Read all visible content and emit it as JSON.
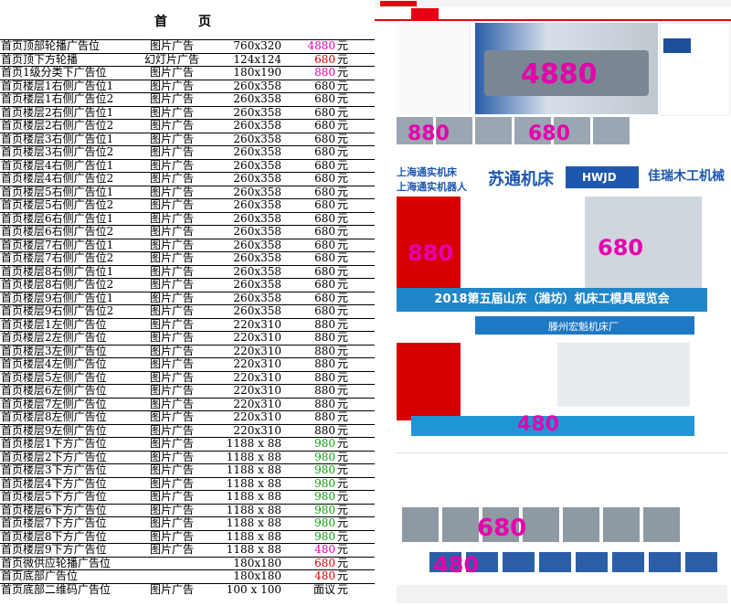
{
  "title": "首　页",
  "rows": [
    {
      "name": "首页顶部轮播广告位",
      "type": "图片广告",
      "size": "760x320",
      "price": "4880",
      "unit": "元",
      "color": "pink"
    },
    {
      "name": "首页顶下方轮播",
      "type": "幻灯片广告",
      "size": "124x124",
      "price": "680",
      "unit": "元",
      "color": "red"
    },
    {
      "name": "首页1级分类下广告位",
      "type": "图片广告",
      "size": "180x190",
      "price": "880",
      "unit": "元",
      "color": "pink"
    },
    {
      "name": "首页楼层1右侧广告位1",
      "type": "图片广告",
      "size": "260x358",
      "price": "680",
      "unit": "元",
      "color": "black"
    },
    {
      "name": "首页楼层1右侧广告位2",
      "type": "图片广告",
      "size": "260x358",
      "price": "680",
      "unit": "元",
      "color": "black"
    },
    {
      "name": "首页楼层2右侧广告位1",
      "type": "图片广告",
      "size": "260x358",
      "price": "680",
      "unit": "元",
      "color": "black"
    },
    {
      "name": "首页楼层2右侧广告位2",
      "type": "图片广告",
      "size": "260x358",
      "price": "680",
      "unit": "元",
      "color": "black"
    },
    {
      "name": "首页楼层3右侧广告位1",
      "type": "图片广告",
      "size": "260x358",
      "price": "680",
      "unit": "元",
      "color": "black"
    },
    {
      "name": "首页楼层3右侧广告位2",
      "type": "图片广告",
      "size": "260x358",
      "price": "680",
      "unit": "元",
      "color": "black"
    },
    {
      "name": "首页楼层4右侧广告位1",
      "type": "图片广告",
      "size": "260x358",
      "price": "680",
      "unit": "元",
      "color": "black"
    },
    {
      "name": "首页楼层4右侧广告位2",
      "type": "图片广告",
      "size": "260x358",
      "price": "680",
      "unit": "元",
      "color": "black"
    },
    {
      "name": "首页楼层5右侧广告位1",
      "type": "图片广告",
      "size": "260x358",
      "price": "680",
      "unit": "元",
      "color": "black"
    },
    {
      "name": "首页楼层5右侧广告位2",
      "type": "图片广告",
      "size": "260x358",
      "price": "680",
      "unit": "元",
      "color": "black"
    },
    {
      "name": "首页楼层6右侧广告位1",
      "type": "图片广告",
      "size": "260x358",
      "price": "680",
      "unit": "元",
      "color": "black"
    },
    {
      "name": "首页楼层6右侧广告位2",
      "type": "图片广告",
      "size": "260x358",
      "price": "680",
      "unit": "元",
      "color": "black"
    },
    {
      "name": "首页楼层7右侧广告位1",
      "type": "图片广告",
      "size": "260x358",
      "price": "680",
      "unit": "元",
      "color": "black"
    },
    {
      "name": "首页楼层7右侧广告位2",
      "type": "图片广告",
      "size": "260x358",
      "price": "680",
      "unit": "元",
      "color": "black"
    },
    {
      "name": "首页楼层8右侧广告位1",
      "type": "图片广告",
      "size": "260x358",
      "price": "680",
      "unit": "元",
      "color": "black"
    },
    {
      "name": "首页楼层8右侧广告位2",
      "type": "图片广告",
      "size": "260x358",
      "price": "680",
      "unit": "元",
      "color": "black"
    },
    {
      "name": "首页楼层9右侧广告位1",
      "type": "图片广告",
      "size": "260x358",
      "price": "680",
      "unit": "元",
      "color": "black"
    },
    {
      "name": "首页楼层9右侧广告位2",
      "type": "图片广告",
      "size": "260x358",
      "price": "680",
      "unit": "元",
      "color": "black"
    },
    {
      "name": "首页楼层1左侧广告位",
      "type": "图片广告",
      "size": "220x310",
      "price": "880",
      "unit": "元",
      "color": "black"
    },
    {
      "name": "首页楼层2左侧广告位",
      "type": "图片广告",
      "size": "220x310",
      "price": "880",
      "unit": "元",
      "color": "black"
    },
    {
      "name": "首页楼层3左侧广告位",
      "type": "图片广告",
      "size": "220x310",
      "price": "880",
      "unit": "元",
      "color": "black"
    },
    {
      "name": "首页楼层4左侧广告位",
      "type": "图片广告",
      "size": "220x310",
      "price": "880",
      "unit": "元",
      "color": "black"
    },
    {
      "name": "首页楼层5左侧广告位",
      "type": "图片广告",
      "size": "220x310",
      "price": "880",
      "unit": "元",
      "color": "black"
    },
    {
      "name": "首页楼层6左侧广告位",
      "type": "图片广告",
      "size": "220x310",
      "price": "880",
      "unit": "元",
      "color": "black"
    },
    {
      "name": "首页楼层7左侧广告位",
      "type": "图片广告",
      "size": "220x310",
      "price": "880",
      "unit": "元",
      "color": "black"
    },
    {
      "name": "首页楼层8左侧广告位",
      "type": "图片广告",
      "size": "220x310",
      "price": "880",
      "unit": "元",
      "color": "black"
    },
    {
      "name": "首页楼层9左侧广告位",
      "type": "图片广告",
      "size": "220x310",
      "price": "880",
      "unit": "元",
      "color": "black"
    },
    {
      "name": "首页楼层1下方广告位",
      "type": "图片广告",
      "size": "1188 x 88",
      "price": "980",
      "unit": "元",
      "color": "green"
    },
    {
      "name": "首页楼层2下方广告位",
      "type": "图片广告",
      "size": "1188 x 88",
      "price": "980",
      "unit": "元",
      "color": "green"
    },
    {
      "name": "首页楼层3下方广告位",
      "type": "图片广告",
      "size": "1188 x 88",
      "price": "980",
      "unit": "元",
      "color": "green"
    },
    {
      "name": "首页楼层4下方广告位",
      "type": "图片广告",
      "size": "1188 x 88",
      "price": "980",
      "unit": "元",
      "color": "green"
    },
    {
      "name": "首页楼层5下方广告位",
      "type": "图片广告",
      "size": "1188 x 88",
      "price": "980",
      "unit": "元",
      "color": "green"
    },
    {
      "name": "首页楼层6下方广告位",
      "type": "图片广告",
      "size": "1188 x 88",
      "price": "980",
      "unit": "元",
      "color": "green"
    },
    {
      "name": "首页楼层7下方广告位",
      "type": "图片广告",
      "size": "1188 x 88",
      "price": "980",
      "unit": "元",
      "color": "green"
    },
    {
      "name": "首页楼层8下方广告位",
      "type": "图片广告",
      "size": "1188 x 88",
      "price": "980",
      "unit": "元",
      "color": "green"
    },
    {
      "name": "首页楼层9下方广告位",
      "type": "图片广告",
      "size": "1188 x 88",
      "price": "480",
      "unit": "元",
      "color": "pink"
    },
    {
      "name": "首页微供应轮播广告位",
      "type": "",
      "size": "180x180",
      "price": "680",
      "unit": "元",
      "color": "red"
    },
    {
      "name": "首页底部广告位",
      "type": "",
      "size": "180x180",
      "price": "480",
      "unit": "元",
      "color": "red"
    },
    {
      "name": "首页底部二维码广告位",
      "type": "图片广告",
      "size": "100 x 100",
      "price": "面议",
      "unit": "元",
      "color": "black"
    }
  ],
  "screenshot": {
    "logo_texts": [
      "上海通实机床",
      "上海通实机器人",
      "苏通机床",
      "HWJD",
      "佳瑞木工机械"
    ],
    "expo_banner": "2018第五届山东（潍坊）机床工模具展览会",
    "company_header": "滕州宏魁机床厂",
    "overlay_prices": [
      "4880",
      "880",
      "680",
      "880",
      "680",
      "480",
      "680",
      "480"
    ]
  },
  "colors": {
    "pink": "#e600ac",
    "red": "#d40000",
    "green": "#119c11",
    "accent": "#e60012",
    "blue": "#1f87c9"
  }
}
